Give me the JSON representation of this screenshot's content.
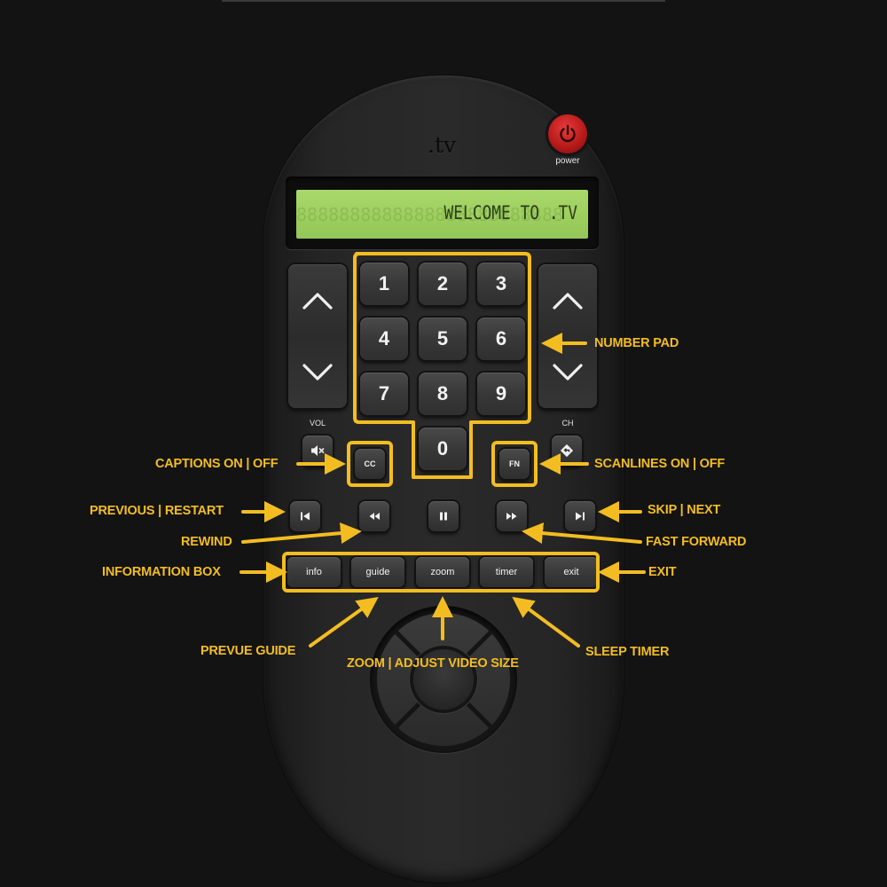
{
  "remote": {
    "logo": ".tv",
    "power_label": "power",
    "lcd": {
      "ghost": "8888888888888888888888888",
      "message": "WELCOME TO .TV"
    },
    "vol_label": "VOL",
    "ch_label": "CH",
    "number_pad": [
      "1",
      "2",
      "3",
      "4",
      "5",
      "6",
      "7",
      "8",
      "9",
      "0"
    ],
    "cc_label": "CC",
    "fn_label": "FN",
    "text_buttons": {
      "info": "info",
      "guide": "guide",
      "zoom": "zoom",
      "timer": "timer",
      "exit": "exit"
    }
  },
  "icons": [
    "power-icon",
    "volume-up-icon",
    "volume-down-icon",
    "mute-icon",
    "channel-up-icon",
    "channel-down-icon",
    "last-channel-icon",
    "previous-icon",
    "rewind-icon",
    "pause-icon",
    "fast-forward-icon",
    "next-icon"
  ],
  "annotations": {
    "number_pad": "NUMBER PAD",
    "captions": "CAPTIONS ON | OFF",
    "scanlines": "SCANLINES ON | OFF",
    "previous": "PREVIOUS | RESTART",
    "skip": "SKIP | NEXT",
    "rewind": "REWIND",
    "fast_forward": "FAST FORWARD",
    "information": "INFORMATION BOX",
    "exit": "EXIT",
    "prevue_guide": "PREVUE GUIDE",
    "zoom": "ZOOM  | ADJUST VIDEO SIZE",
    "sleep_timer": "SLEEP TIMER"
  },
  "colors": {
    "annotation": "#f3bd22",
    "lcd": "#9ed060",
    "power": "#c41e1e",
    "body": "#262626"
  }
}
